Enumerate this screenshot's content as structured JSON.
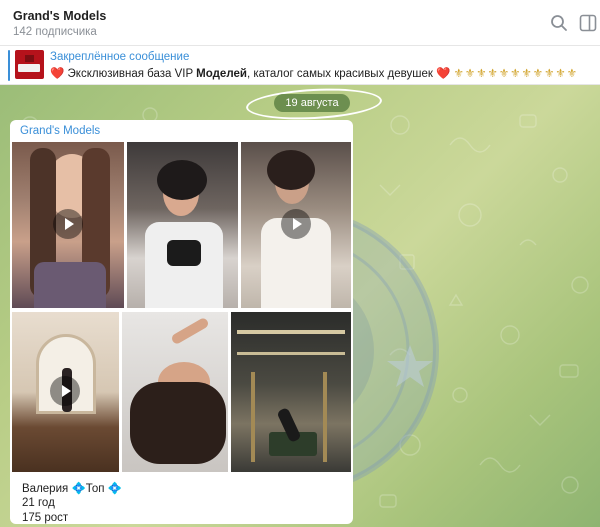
{
  "header": {
    "title": "Grand's Models",
    "subscribers": "142 подписчика",
    "search_icon": "search-icon",
    "panel_icon": "sidebar-panel-icon"
  },
  "pinned": {
    "title": "Закреплённое сообщение",
    "text_before": "Эксклюзивная база VIP",
    "text_bold": "Моделей",
    "text_after": ", каталог самых красивых девушек",
    "heart": "❤️",
    "fleurs": "⚜⚜⚜⚜⚜⚜⚜⚜⚜⚜⚜"
  },
  "chat": {
    "date": "19 августа"
  },
  "message": {
    "author": "Grand's Models",
    "caption_name": "Валерия",
    "caption_badge": "Топ",
    "gem": "💠",
    "age": "21 год",
    "height": "175 рост"
  },
  "colors": {
    "accent": "#3a8fd8",
    "chat_bg": "#b8cd86",
    "date_pill": "#537a3c"
  }
}
